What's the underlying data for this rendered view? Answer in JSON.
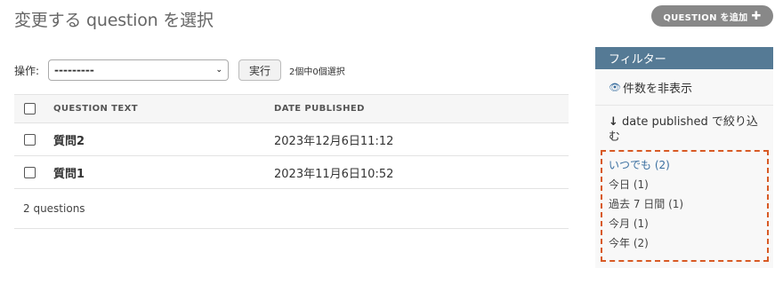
{
  "header": {
    "title": "変更する question を選択",
    "add_button_label": "QUESTION を追加"
  },
  "actions": {
    "label": "操作:",
    "select_value": "---------",
    "run_label": "実行",
    "selection_count": "2個中0個選択"
  },
  "table": {
    "columns": [
      "QUESTION TEXT",
      "DATE PUBLISHED"
    ],
    "rows": [
      {
        "question": "質問2",
        "date": "2023年12月6日11:12"
      },
      {
        "question": "質問1",
        "date": "2023年11月6日10:52"
      }
    ],
    "paginator": "2 questions"
  },
  "filter": {
    "title": "フィルター",
    "hide_counts": "件数を非表示",
    "filter_by": "date published で絞り込む",
    "choices": [
      "いつでも (2)",
      "今日 (1)",
      "過去 7 日間 (1)",
      "今月 (1)",
      "今年 (2)"
    ],
    "selected_index": 0
  },
  "colors": {
    "filter_header": "#557a95",
    "highlight_border": "#d85a25",
    "link": "#3a6fa0"
  }
}
